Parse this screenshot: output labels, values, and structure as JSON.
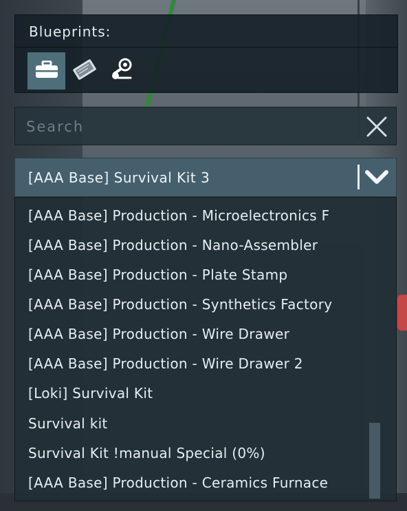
{
  "blueprints": {
    "title": "Blueprints:",
    "tabs": [
      {
        "icon": "toolbox-icon",
        "active": true
      },
      {
        "icon": "datapad-icon",
        "active": false
      },
      {
        "icon": "workshop-icon",
        "active": false
      }
    ]
  },
  "search": {
    "placeholder": "Search",
    "value": ""
  },
  "dropdown": {
    "selected": "[AAA Base] Survival Kit 3",
    "items": [
      "[AAA Base] Production - Microelectronics F",
      "[AAA Base] Production - Nano-Assembler",
      "[AAA Base] Production - Plate Stamp",
      "[AAA Base] Production - Synthetics Factory",
      "[AAA Base] Production - Wire Drawer",
      "[AAA Base] Production - Wire Drawer 2",
      "[Loki] Survival Kit",
      "Survival kit",
      "Survival Kit !manual Special (0%)",
      "[AAA Base] Production - Ceramics Furnace"
    ]
  },
  "colors": {
    "panel_bg": "#16202a",
    "active_tab": "#4e6e7a",
    "dropdown_header": "#45606c",
    "text": "#e6eef2"
  }
}
